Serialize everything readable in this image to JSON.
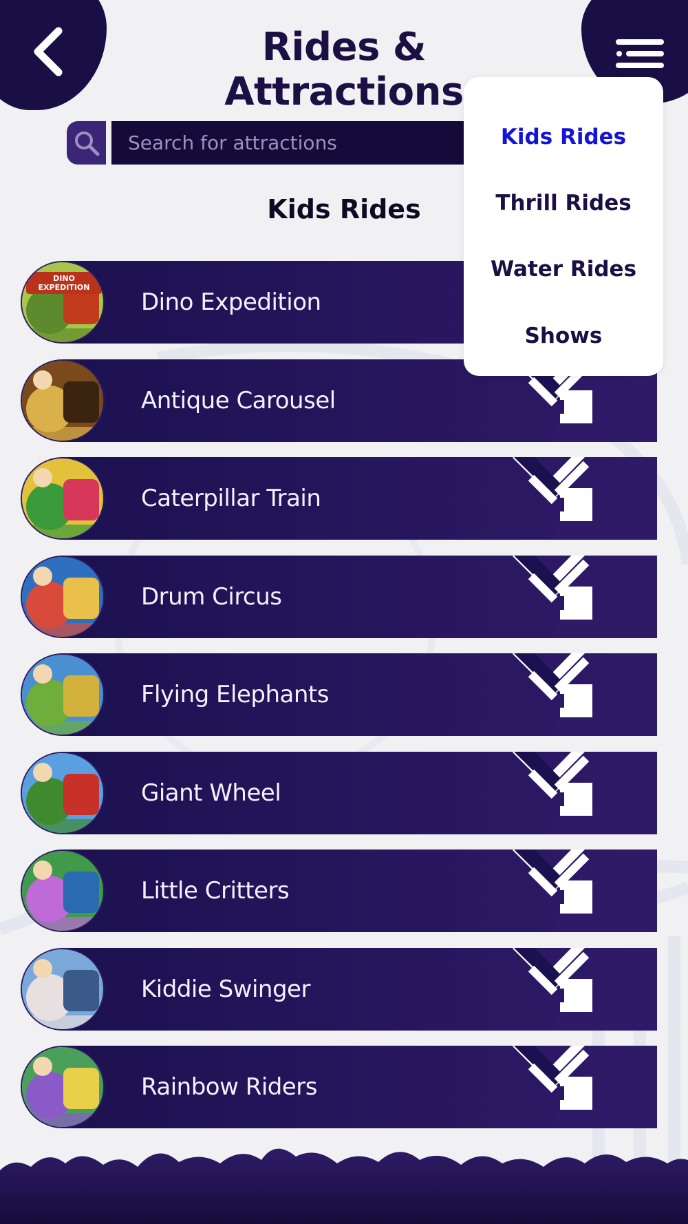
{
  "header": {
    "title": "Rides & Attractions",
    "back_icon": "chevron-left-icon",
    "menu_icon": "menu-list-icon"
  },
  "search": {
    "placeholder": "Search for attractions",
    "icon": "search-icon"
  },
  "section": {
    "title": "Kids Rides"
  },
  "rides": [
    {
      "label": "Dino Expedition",
      "thumb_text": "DINO EXPEDITION"
    },
    {
      "label": "Antique Carousel"
    },
    {
      "label": "Caterpillar Train"
    },
    {
      "label": "Drum Circus"
    },
    {
      "label": "Flying Elephants"
    },
    {
      "label": "Giant Wheel"
    },
    {
      "label": "Little Critters"
    },
    {
      "label": "Kiddie Swinger"
    },
    {
      "label": "Rainbow Riders"
    }
  ],
  "dropdown": {
    "items": [
      {
        "label": "Kids Rides",
        "active": true
      },
      {
        "label": "Thrill Rides",
        "active": false
      },
      {
        "label": "Water Rides",
        "active": false
      },
      {
        "label": "Shows",
        "active": false
      }
    ]
  },
  "colors": {
    "primary_dark": "#1a0f45",
    "bar_dark": "#1c1150",
    "bar_light": "#2f1a68",
    "active_menu": "#1414d6",
    "background": "#f1f1f3"
  }
}
